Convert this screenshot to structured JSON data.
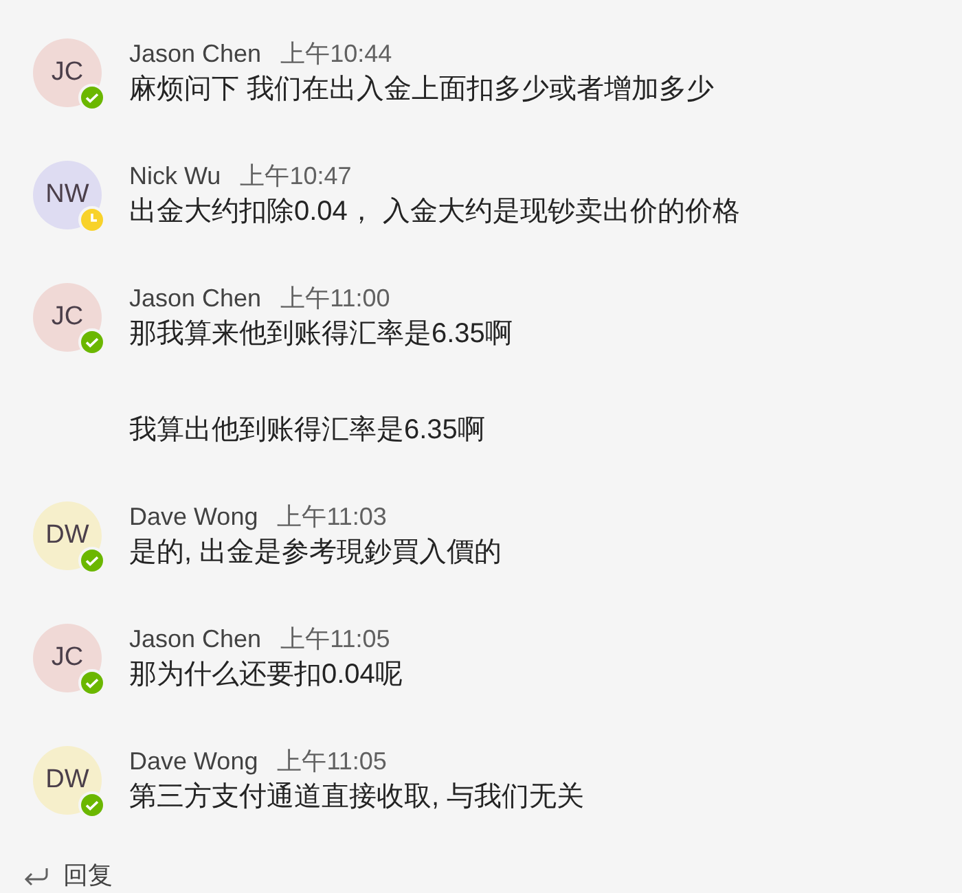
{
  "messages": [
    {
      "author": "Jason Chen",
      "time": "上午10:44",
      "avatar": {
        "initials": "JC",
        "color": "#f0d9d6",
        "away": false
      },
      "paragraphs": [
        "麻烦问下 我们在出入金上面扣多少或者增加多少"
      ]
    },
    {
      "author": "Nick Wu",
      "time": "上午10:47",
      "avatar": {
        "initials": "NW",
        "color": "#dedcf2",
        "away": true
      },
      "paragraphs": [
        "出金大约扣除0.04，  入金大约是现钞卖出价的价格"
      ]
    },
    {
      "author": "Jason Chen",
      "time": "上午11:00",
      "avatar": {
        "initials": "JC",
        "color": "#f0d9d6",
        "away": false
      },
      "paragraphs": [
        "那我算来他到账得汇率是6.35啊",
        "我算出他到账得汇率是6.35啊"
      ]
    },
    {
      "author": "Dave Wong",
      "time": "上午11:03",
      "avatar": {
        "initials": "DW",
        "color": "#f6efcb",
        "away": false
      },
      "paragraphs": [
        "是的, 出金是参考現鈔買入價的"
      ]
    },
    {
      "author": "Jason Chen",
      "time": "上午11:05",
      "avatar": {
        "initials": "JC",
        "color": "#f0d9d6",
        "away": false
      },
      "paragraphs": [
        "那为什么还要扣0.04呢"
      ]
    },
    {
      "author": "Dave Wong",
      "time": "上午11:05",
      "avatar": {
        "initials": "DW",
        "color": "#f6efcb",
        "away": false
      },
      "paragraphs": [
        "第三方支付通道直接收取, 与我们无关"
      ]
    }
  ],
  "reply": {
    "label": "回复"
  }
}
